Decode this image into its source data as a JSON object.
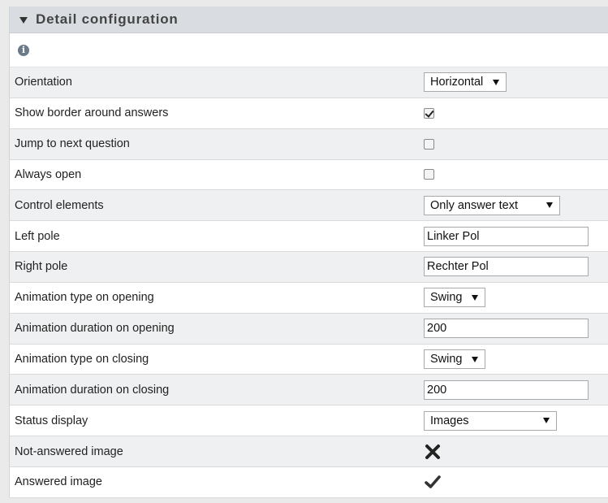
{
  "panel": {
    "title": "Detail configuration"
  },
  "settings": [
    {
      "label": "Orientation",
      "control": "select",
      "value": "Horizontal"
    },
    {
      "label": "Show border around answers",
      "control": "checkbox",
      "checked": true
    },
    {
      "label": "Jump to next question",
      "control": "checkbox",
      "checked": false
    },
    {
      "label": "Always open",
      "control": "checkbox",
      "checked": false
    },
    {
      "label": "Control elements",
      "control": "select",
      "value": "Only answer text"
    },
    {
      "label": "Left pole",
      "control": "text",
      "value": "Linker Pol"
    },
    {
      "label": "Right pole",
      "control": "text",
      "value": "Rechter Pol"
    },
    {
      "label": "Animation type on opening",
      "control": "select",
      "value": "Swing"
    },
    {
      "label": "Animation duration on opening",
      "control": "text",
      "value": "200"
    },
    {
      "label": "Animation type on closing",
      "control": "select",
      "value": "Swing"
    },
    {
      "label": "Animation duration on closing",
      "control": "text",
      "value": "200"
    },
    {
      "label": "Status display",
      "control": "select",
      "value": "Images"
    },
    {
      "label": "Not-answered image",
      "control": "icon",
      "icon": "cross-icon"
    },
    {
      "label": "Answered image",
      "control": "icon",
      "icon": "check-icon"
    }
  ],
  "icons": {
    "info": "i"
  },
  "colors": {
    "header_bg": "#d9dde2",
    "alt_row_bg": "#eef0f2",
    "info_icon": "#6c7b8a"
  }
}
